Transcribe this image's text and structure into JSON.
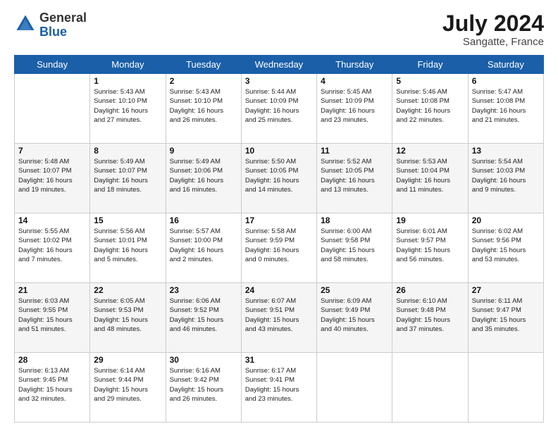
{
  "header": {
    "logo_general": "General",
    "logo_blue": "Blue",
    "month_year": "July 2024",
    "location": "Sangatte, France"
  },
  "days_of_week": [
    "Sunday",
    "Monday",
    "Tuesday",
    "Wednesday",
    "Thursday",
    "Friday",
    "Saturday"
  ],
  "weeks": [
    [
      {
        "day": "",
        "info": ""
      },
      {
        "day": "1",
        "info": "Sunrise: 5:43 AM\nSunset: 10:10 PM\nDaylight: 16 hours\nand 27 minutes."
      },
      {
        "day": "2",
        "info": "Sunrise: 5:43 AM\nSunset: 10:10 PM\nDaylight: 16 hours\nand 26 minutes."
      },
      {
        "day": "3",
        "info": "Sunrise: 5:44 AM\nSunset: 10:09 PM\nDaylight: 16 hours\nand 25 minutes."
      },
      {
        "day": "4",
        "info": "Sunrise: 5:45 AM\nSunset: 10:09 PM\nDaylight: 16 hours\nand 23 minutes."
      },
      {
        "day": "5",
        "info": "Sunrise: 5:46 AM\nSunset: 10:08 PM\nDaylight: 16 hours\nand 22 minutes."
      },
      {
        "day": "6",
        "info": "Sunrise: 5:47 AM\nSunset: 10:08 PM\nDaylight: 16 hours\nand 21 minutes."
      }
    ],
    [
      {
        "day": "7",
        "info": "Sunrise: 5:48 AM\nSunset: 10:07 PM\nDaylight: 16 hours\nand 19 minutes."
      },
      {
        "day": "8",
        "info": "Sunrise: 5:49 AM\nSunset: 10:07 PM\nDaylight: 16 hours\nand 18 minutes."
      },
      {
        "day": "9",
        "info": "Sunrise: 5:49 AM\nSunset: 10:06 PM\nDaylight: 16 hours\nand 16 minutes."
      },
      {
        "day": "10",
        "info": "Sunrise: 5:50 AM\nSunset: 10:05 PM\nDaylight: 16 hours\nand 14 minutes."
      },
      {
        "day": "11",
        "info": "Sunrise: 5:52 AM\nSunset: 10:05 PM\nDaylight: 16 hours\nand 13 minutes."
      },
      {
        "day": "12",
        "info": "Sunrise: 5:53 AM\nSunset: 10:04 PM\nDaylight: 16 hours\nand 11 minutes."
      },
      {
        "day": "13",
        "info": "Sunrise: 5:54 AM\nSunset: 10:03 PM\nDaylight: 16 hours\nand 9 minutes."
      }
    ],
    [
      {
        "day": "14",
        "info": "Sunrise: 5:55 AM\nSunset: 10:02 PM\nDaylight: 16 hours\nand 7 minutes."
      },
      {
        "day": "15",
        "info": "Sunrise: 5:56 AM\nSunset: 10:01 PM\nDaylight: 16 hours\nand 5 minutes."
      },
      {
        "day": "16",
        "info": "Sunrise: 5:57 AM\nSunset: 10:00 PM\nDaylight: 16 hours\nand 2 minutes."
      },
      {
        "day": "17",
        "info": "Sunrise: 5:58 AM\nSunset: 9:59 PM\nDaylight: 16 hours\nand 0 minutes."
      },
      {
        "day": "18",
        "info": "Sunrise: 6:00 AM\nSunset: 9:58 PM\nDaylight: 15 hours\nand 58 minutes."
      },
      {
        "day": "19",
        "info": "Sunrise: 6:01 AM\nSunset: 9:57 PM\nDaylight: 15 hours\nand 56 minutes."
      },
      {
        "day": "20",
        "info": "Sunrise: 6:02 AM\nSunset: 9:56 PM\nDaylight: 15 hours\nand 53 minutes."
      }
    ],
    [
      {
        "day": "21",
        "info": "Sunrise: 6:03 AM\nSunset: 9:55 PM\nDaylight: 15 hours\nand 51 minutes."
      },
      {
        "day": "22",
        "info": "Sunrise: 6:05 AM\nSunset: 9:53 PM\nDaylight: 15 hours\nand 48 minutes."
      },
      {
        "day": "23",
        "info": "Sunrise: 6:06 AM\nSunset: 9:52 PM\nDaylight: 15 hours\nand 46 minutes."
      },
      {
        "day": "24",
        "info": "Sunrise: 6:07 AM\nSunset: 9:51 PM\nDaylight: 15 hours\nand 43 minutes."
      },
      {
        "day": "25",
        "info": "Sunrise: 6:09 AM\nSunset: 9:49 PM\nDaylight: 15 hours\nand 40 minutes."
      },
      {
        "day": "26",
        "info": "Sunrise: 6:10 AM\nSunset: 9:48 PM\nDaylight: 15 hours\nand 37 minutes."
      },
      {
        "day": "27",
        "info": "Sunrise: 6:11 AM\nSunset: 9:47 PM\nDaylight: 15 hours\nand 35 minutes."
      }
    ],
    [
      {
        "day": "28",
        "info": "Sunrise: 6:13 AM\nSunset: 9:45 PM\nDaylight: 15 hours\nand 32 minutes."
      },
      {
        "day": "29",
        "info": "Sunrise: 6:14 AM\nSunset: 9:44 PM\nDaylight: 15 hours\nand 29 minutes."
      },
      {
        "day": "30",
        "info": "Sunrise: 6:16 AM\nSunset: 9:42 PM\nDaylight: 15 hours\nand 26 minutes."
      },
      {
        "day": "31",
        "info": "Sunrise: 6:17 AM\nSunset: 9:41 PM\nDaylight: 15 hours\nand 23 minutes."
      },
      {
        "day": "",
        "info": ""
      },
      {
        "day": "",
        "info": ""
      },
      {
        "day": "",
        "info": ""
      }
    ]
  ]
}
